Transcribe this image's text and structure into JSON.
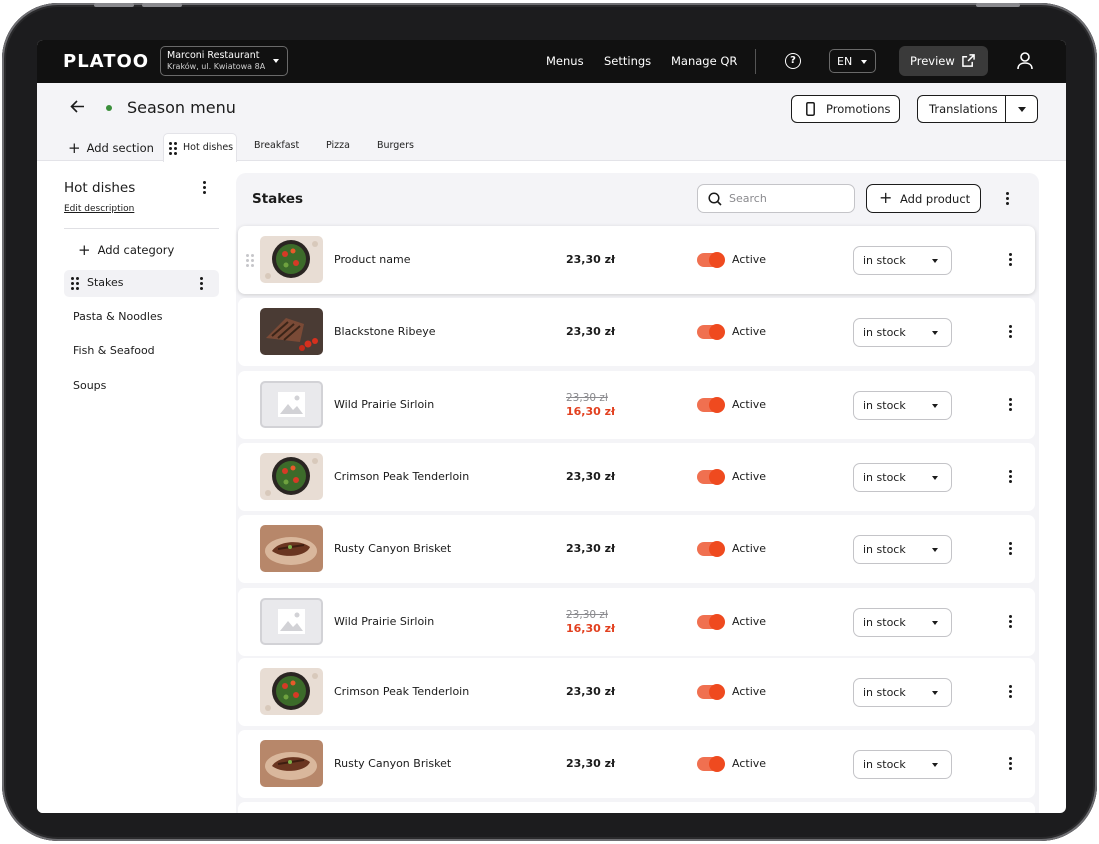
{
  "topbar": {
    "logo": "PLATOO",
    "restaurant": {
      "name": "Marconi Restaurant",
      "address": "Kraków, ul. Kwiatowa 8A"
    },
    "nav": [
      "Menus",
      "Settings",
      "Manage QR"
    ],
    "help": "?",
    "language": "EN",
    "preview_label": "Preview"
  },
  "header": {
    "title": "Season menu",
    "promotions_label": "Promotions",
    "translations_label": "Translations",
    "add_section_label": "Add section",
    "tabs": [
      "Hot dishes",
      "Breakfast",
      "Pizza",
      "Burgers"
    ]
  },
  "sidebar": {
    "title": "Hot dishes",
    "edit_description": "Edit description",
    "add_category": "Add category",
    "categories": [
      "Stakes",
      "Pasta & Noodles",
      "Fish & Seafood",
      "Soups"
    ]
  },
  "panel": {
    "title": "Stakes",
    "search_placeholder": "Search",
    "add_product_label": "Add product",
    "products": [
      {
        "name": "Product name",
        "price": "23,30 zł",
        "old_price": "",
        "status": "Active",
        "stock": "in stock",
        "image": "salad"
      },
      {
        "name": "Blackstone Ribeye",
        "price": "23,30 zł",
        "old_price": "",
        "status": "Active",
        "stock": "in stock",
        "image": "steak-dark"
      },
      {
        "name": "Wild Prairie Sirloin",
        "price": "16,30 zł",
        "old_price": "23,30 zł",
        "status": "Active",
        "stock": "in stock",
        "image": "placeholder"
      },
      {
        "name": "Crimson Peak Tenderloin",
        "price": "23,30 zł",
        "old_price": "",
        "status": "Active",
        "stock": "in stock",
        "image": "salad"
      },
      {
        "name": "Rusty Canyon Brisket",
        "price": "23,30 zł",
        "old_price": "",
        "status": "Active",
        "stock": "in stock",
        "image": "steak-plate"
      },
      {
        "name": "Wild Prairie Sirloin",
        "price": "16,30 zł",
        "old_price": "23,30 zł",
        "status": "Active",
        "stock": "in stock",
        "image": "placeholder"
      },
      {
        "name": "Crimson Peak Tenderloin",
        "price": "23,30 zł",
        "old_price": "",
        "status": "Active",
        "stock": "in stock",
        "image": "salad"
      },
      {
        "name": "Rusty Canyon Brisket",
        "price": "23,30 zł",
        "old_price": "",
        "status": "Active",
        "stock": "in stock",
        "image": "steak-plate"
      }
    ]
  },
  "colors": {
    "accent": "#ef4a1f",
    "dark": "#111111",
    "status_green": "#3b8f3b"
  }
}
